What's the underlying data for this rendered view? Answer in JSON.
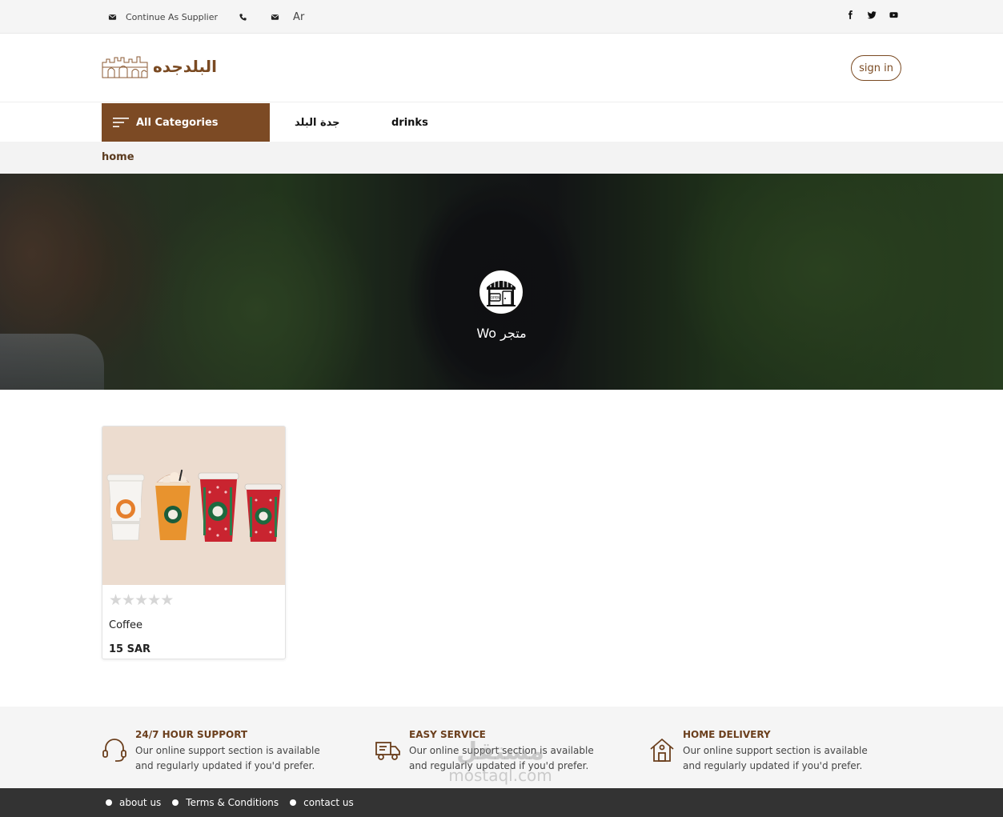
{
  "topbar": {
    "supplier_label": "Continue As Supplier",
    "language": "Ar",
    "icons": [
      "mail-icon",
      "phone-icon",
      "mail-icon"
    ],
    "social": [
      "facebook-icon",
      "twitter-icon",
      "youtube-icon"
    ]
  },
  "header": {
    "logo_text": "البلدجده",
    "signin_label": "sign in"
  },
  "nav": {
    "all_categories": "All Categories",
    "links": [
      "جدة البلد",
      "drinks"
    ]
  },
  "breadcrumb": {
    "current": "home"
  },
  "store": {
    "name": "Wo متجر"
  },
  "products": [
    {
      "name": "Coffee",
      "price": "15 SAR",
      "rating": 0,
      "max_rating": 5
    }
  ],
  "features": [
    {
      "title": "24/7 HOUR SUPPORT",
      "text": "Our online support section is available and regularly updated if you'd prefer.",
      "icon": "headset-icon"
    },
    {
      "title": "EASY SERVICE",
      "text": "Our online support section is available and regularly updated if you'd prefer.",
      "icon": "truck-icon"
    },
    {
      "title": "HOME DELIVERY",
      "text": "Our online support section is available and regularly updated if you'd prefer.",
      "icon": "home-icon"
    }
  ],
  "footer": {
    "links": [
      "about us",
      "Terms & Conditions",
      "contact us"
    ]
  },
  "watermark": {
    "arabic": "مستقل",
    "latin": "mostaql.com"
  },
  "colors": {
    "brand_brown": "#7c4a24",
    "footer_bg": "#333333",
    "topbar_bg": "#f5f5f5"
  }
}
